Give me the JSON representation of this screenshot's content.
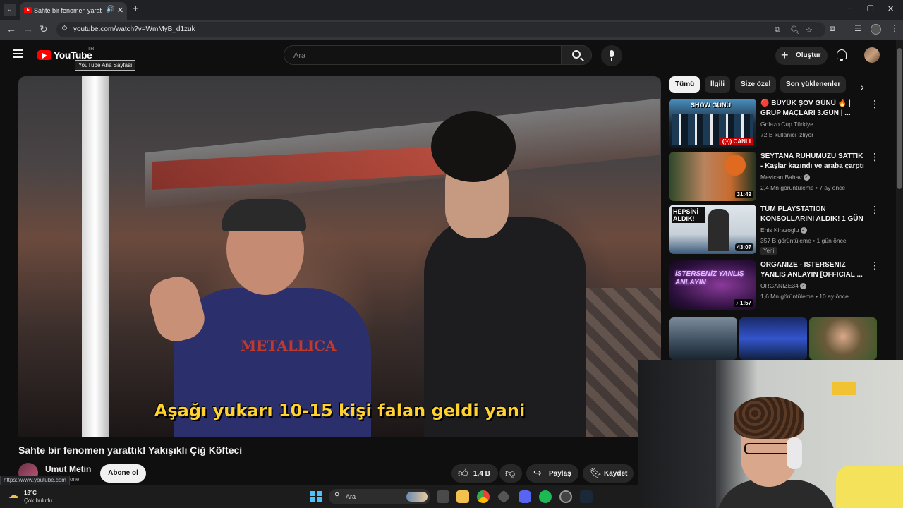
{
  "browser": {
    "tab_title": "Sahte bir fenomen yarattık!",
    "url": "youtube.com/watch?v=WmMyB_d1zuk",
    "new_tab": "+",
    "close": "✕",
    "audio": "🔊"
  },
  "header": {
    "logo_text": "YouTube",
    "country": "TR",
    "tooltip": "YouTube Ana Sayfası",
    "search_placeholder": "Ara",
    "create_label": "Oluştur"
  },
  "video": {
    "subtitle": "Aşağı yukarı 10-15 kişi falan geldi yani",
    "shirt_text": "METALLICA",
    "title": "Sahte bir fenomen yarattık! Yakışıklı Çiğ Köfteci",
    "channel": "Umut Metin",
    "subs_fragment": "one",
    "subscribe_label": "Abone ol",
    "likes": "1,4 B",
    "share_label": "Paylaş",
    "save_label": "Kaydet"
  },
  "status_url": "https://www.youtube.com",
  "chips": [
    "Tümü",
    "İlgili",
    "Size özel",
    "Son yüklenenler"
  ],
  "recommendations": [
    {
      "title": "🔴 BÜYÜK ŞOV GÜNÜ 🔥 | GRUP MAÇLARI 3.GÜN | ...",
      "channel": "Golazo Cup Türkiye",
      "meta": "72 B kullanıcı izliyor",
      "badge": "((•)) CANLI",
      "thumb_text": "SHOW GÜNÜ",
      "verified": false,
      "new": ""
    },
    {
      "title": "ŞEYTANA RUHUMUZU SATTIK - Kaşlar kazındı ve araba çarptı ...",
      "channel": "Mevtcan Bahav",
      "meta": "2,4 Mn görüntüleme • 7 ay önce",
      "badge": "31:49",
      "thumb_text": "",
      "verified": true,
      "new": ""
    },
    {
      "title": "TÜM PLAYSTATION KONSOLLARINI ALDIK! 1 GÜN ...",
      "channel": "Enis Kirazoglu",
      "meta": "357 B görüntüleme • 1 gün önce",
      "badge": "43:07",
      "thumb_text": "HEPSİNİ ALDIK!",
      "verified": true,
      "new": "Yeni"
    },
    {
      "title": "ORGANIZE - ISTERSENIZ YANLIS ANLAYIN [OFFICIAL ...",
      "channel": "ORGANIZE34",
      "meta": "1,6 Mn görüntüleme • 10 ay önce",
      "badge": "♪ 1:57",
      "thumb_text": "İSTERSENİZ YANLIŞ ANLAYIN",
      "verified": true,
      "new": ""
    }
  ],
  "taskbar": {
    "temp": "18°C",
    "weather": "Çok bulutlu",
    "search": "Ara"
  }
}
